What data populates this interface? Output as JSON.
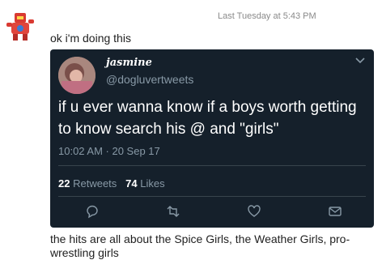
{
  "chat": {
    "timestamp": "Last Tuesday at 5:43 PM",
    "message": "ok i'm doing this",
    "caption": "the hits are all about the Spice Girls, the Weather Girls, pro-wrestling girls"
  },
  "tweet": {
    "name": "jasmine",
    "handle": "@dogluvertweets",
    "text": "if u ever wanna know if a boys worth getting to know search his @ and \"girls\"",
    "time": "10:02 AM · 20 Sep 17",
    "retweets_count": "22",
    "retweets_label": "Retweets",
    "likes_count": "74",
    "likes_label": "Likes",
    "actions": [
      "reply-icon",
      "retweet-icon",
      "like-icon",
      "message-icon"
    ]
  },
  "colors": {
    "card_bg": "#15202b",
    "muted": "#8899a6",
    "divider": "#38444d"
  }
}
